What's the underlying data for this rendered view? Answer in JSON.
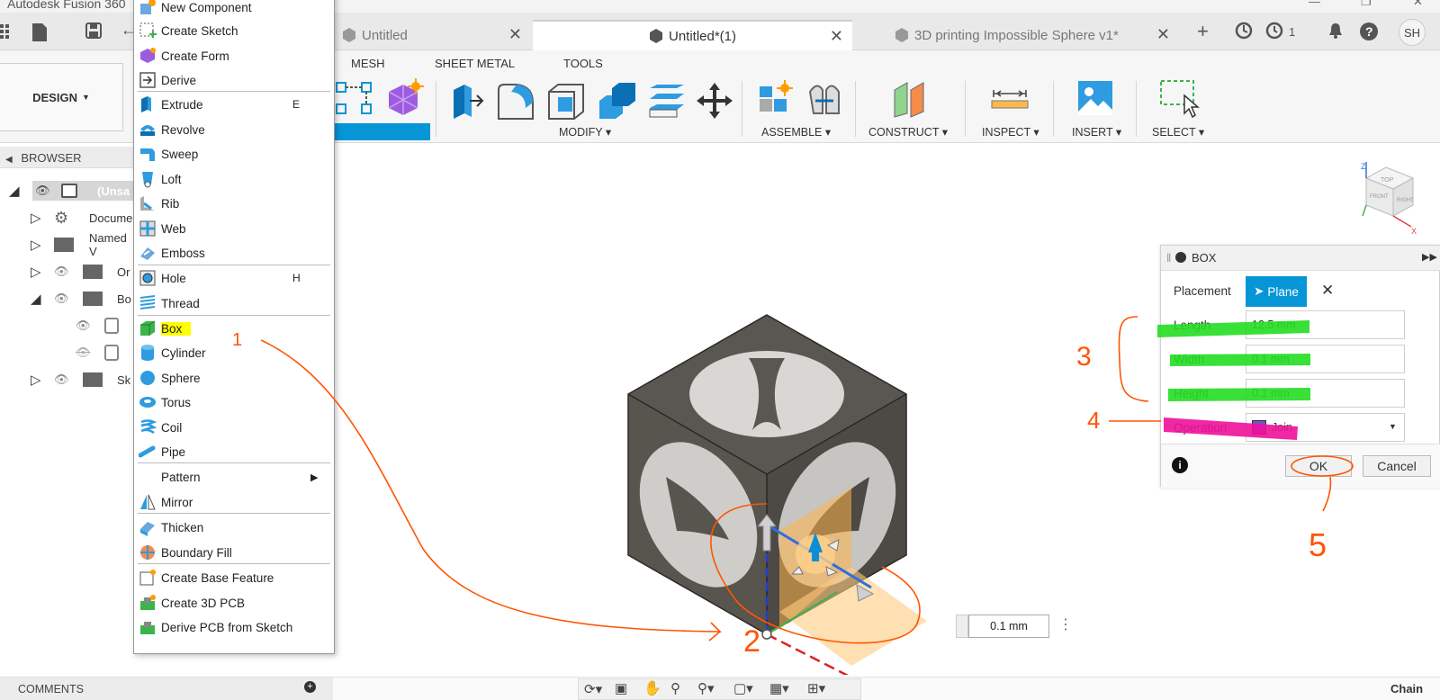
{
  "window": {
    "app_title": "Autodesk Fusion 360"
  },
  "tabs": [
    {
      "label": "Untitled"
    },
    {
      "label": "Untitled*(1)"
    },
    {
      "label": "3D printing Impossible Sphere v1*"
    }
  ],
  "header": {
    "job_count": "1",
    "user_initials": "SH"
  },
  "ribbon": {
    "workspace": "DESIGN",
    "tabs": [
      "MESH",
      "SHEET METAL",
      "TOOLS"
    ],
    "groups": [
      "MODIFY",
      "ASSEMBLE",
      "CONSTRUCT",
      "INSPECT",
      "INSERT",
      "SELECT"
    ]
  },
  "browser": {
    "title": "BROWSER",
    "items": [
      "(Unsa",
      "Docume",
      "Named V",
      "Or",
      "Bo",
      "Sk"
    ]
  },
  "menu": {
    "items": [
      {
        "label": "New Component",
        "shortcut": ""
      },
      {
        "label": "Create Sketch",
        "shortcut": ""
      },
      {
        "label": "Create Form",
        "shortcut": ""
      },
      {
        "label": "Derive",
        "shortcut": ""
      },
      {
        "label": "Extrude",
        "shortcut": "E"
      },
      {
        "label": "Revolve",
        "shortcut": ""
      },
      {
        "label": "Sweep",
        "shortcut": ""
      },
      {
        "label": "Loft",
        "shortcut": ""
      },
      {
        "label": "Rib",
        "shortcut": ""
      },
      {
        "label": "Web",
        "shortcut": ""
      },
      {
        "label": "Emboss",
        "shortcut": ""
      },
      {
        "label": "Hole",
        "shortcut": "H"
      },
      {
        "label": "Thread",
        "shortcut": ""
      },
      {
        "label": "Box",
        "shortcut": ""
      },
      {
        "label": "Cylinder",
        "shortcut": ""
      },
      {
        "label": "Sphere",
        "shortcut": ""
      },
      {
        "label": "Torus",
        "shortcut": ""
      },
      {
        "label": "Coil",
        "shortcut": ""
      },
      {
        "label": "Pipe",
        "shortcut": ""
      },
      {
        "label": "Pattern",
        "shortcut": ""
      },
      {
        "label": "Mirror",
        "shortcut": ""
      },
      {
        "label": "Thicken",
        "shortcut": ""
      },
      {
        "label": "Boundary Fill",
        "shortcut": ""
      },
      {
        "label": "Create Base Feature",
        "shortcut": ""
      },
      {
        "label": "Create 3D PCB",
        "shortcut": ""
      },
      {
        "label": "Derive PCB from Sketch",
        "shortcut": ""
      }
    ],
    "highlight_color": "#ffff00"
  },
  "box_panel": {
    "title": "BOX",
    "placement_label": "Placement",
    "plane_label": "Plane",
    "length_label": "Length",
    "length_value": "12.5 mm",
    "width_label": "Width",
    "width_value": "0.1 mm",
    "height_label": "Height",
    "height_value": "0.1 mm",
    "operation_label": "Operation",
    "operation_value": "Join",
    "ok_label": "OK",
    "cancel_label": "Cancel"
  },
  "viewport": {
    "dimension_value": "0.1 mm",
    "viewcube_labels": [
      "TOP",
      "FRONT",
      "RIGHT"
    ]
  },
  "annotations": [
    "1",
    "2",
    "3",
    "4",
    "5"
  ],
  "bottom": {
    "comments_label": "COMMENTS",
    "status_right": "Chain"
  },
  "colors": {
    "accent": "#0696d7",
    "annot_green": "#22dd22",
    "annot_magenta": "#ee1199",
    "annot_orange": "#ff5500"
  }
}
